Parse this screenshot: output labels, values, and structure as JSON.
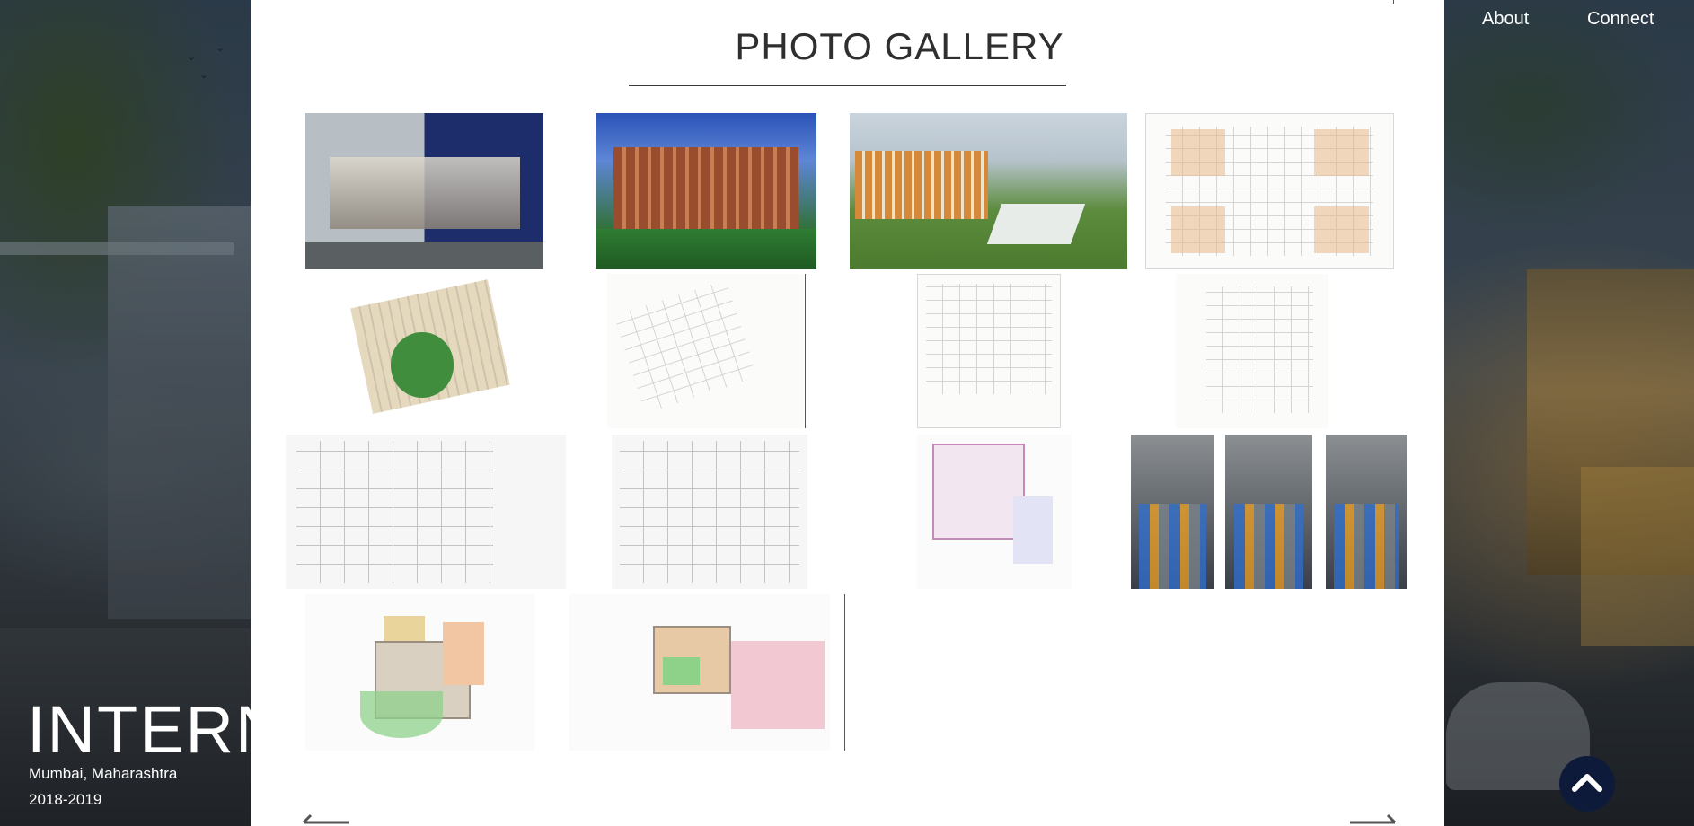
{
  "nav": {
    "about": "About",
    "connect": "Connect"
  },
  "gallery": {
    "title": "PHOTO GALLERY",
    "thumbnails": [
      {
        "kind": "render"
      },
      {
        "kind": "render"
      },
      {
        "kind": "render"
      },
      {
        "kind": "plan"
      },
      {
        "kind": "site-plan"
      },
      {
        "kind": "site-plan"
      },
      {
        "kind": "plan"
      },
      {
        "kind": "plan"
      },
      {
        "kind": "office-plan"
      },
      {
        "kind": "office-plan"
      },
      {
        "kind": "color-plan"
      },
      {
        "kind": "photo"
      },
      {
        "kind": "photo"
      },
      {
        "kind": "photo"
      },
      {
        "kind": "color-plan"
      },
      {
        "kind": "color-plan"
      }
    ],
    "prev_icon": "arrow-left-icon",
    "next_icon": "arrow-right-icon"
  },
  "hero": {
    "title": "INTERNSHIP",
    "location": "Mumbai, Maharashtra",
    "years": "2018-2019"
  },
  "scroll_top": {
    "icon": "chevron-up-icon",
    "color": "#0e1a3a"
  }
}
